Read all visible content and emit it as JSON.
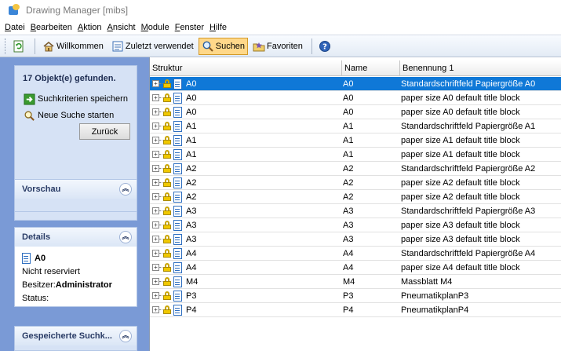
{
  "window": {
    "title": "Drawing Manager [mibs]"
  },
  "menu": [
    "Datei",
    "Bearbeiten",
    "Aktion",
    "Ansicht",
    "Module",
    "Fenster",
    "Hilfe"
  ],
  "toolbar": {
    "items": [
      {
        "label": "Willkommen",
        "icon": "home-icon"
      },
      {
        "label": "Zuletzt verwendet",
        "icon": "recent-icon"
      },
      {
        "label": "Suchen",
        "icon": "search-icon",
        "active": true
      },
      {
        "label": "Favoriten",
        "icon": "favorites-icon"
      }
    ]
  },
  "left": {
    "search": {
      "found_text": "17 Objekt(e) gefunden.",
      "save_criteria": "Suchkriterien speichern",
      "new_search": "Neue Suche starten",
      "back": "Zurück"
    },
    "preview": {
      "title": "Vorschau"
    },
    "details": {
      "title": "Details",
      "object_name": "A0",
      "reserved": "Nicht reserviert",
      "owner_label": "Besitzer:",
      "owner_value": "Administrator",
      "status_label": "Status:"
    },
    "saved": {
      "title": "Gespeicherte Suchk..."
    }
  },
  "table": {
    "columns": [
      "Struktur",
      "Name",
      "Benennung 1"
    ],
    "rows": [
      {
        "struktur": "A0",
        "name": "A0",
        "benennung": "Standardschriftfeld Papiergröße A0",
        "selected": true
      },
      {
        "struktur": "A0",
        "name": "A0",
        "benennung": "paper size A0 default title block"
      },
      {
        "struktur": "A0",
        "name": "A0",
        "benennung": "paper size A0 default title block"
      },
      {
        "struktur": "A1",
        "name": "A1",
        "benennung": "Standardschriftfeld Papiergröße A1"
      },
      {
        "struktur": "A1",
        "name": "A1",
        "benennung": "paper size A1 default title block"
      },
      {
        "struktur": "A1",
        "name": "A1",
        "benennung": "paper size A1 default title block"
      },
      {
        "struktur": "A2",
        "name": "A2",
        "benennung": "Standardschriftfeld Papiergröße A2"
      },
      {
        "struktur": "A2",
        "name": "A2",
        "benennung": "paper size A2 default title block"
      },
      {
        "struktur": "A2",
        "name": "A2",
        "benennung": "paper size A2 default title block"
      },
      {
        "struktur": "A3",
        "name": "A3",
        "benennung": "Standardschriftfeld Papiergröße A3"
      },
      {
        "struktur": "A3",
        "name": "A3",
        "benennung": "paper size A3 default title block"
      },
      {
        "struktur": "A3",
        "name": "A3",
        "benennung": "paper size A3 default title block"
      },
      {
        "struktur": "A4",
        "name": "A4",
        "benennung": "Standardschriftfeld Papiergröße A4"
      },
      {
        "struktur": "A4",
        "name": "A4",
        "benennung": "paper size A4 default title block"
      },
      {
        "struktur": "M4",
        "name": "M4",
        "benennung": "Massblatt M4"
      },
      {
        "struktur": "P3",
        "name": "P3",
        "benennung": "PneumatikplanP3"
      },
      {
        "struktur": "P4",
        "name": "P4",
        "benennung": "PneumatikplanP4"
      }
    ]
  }
}
